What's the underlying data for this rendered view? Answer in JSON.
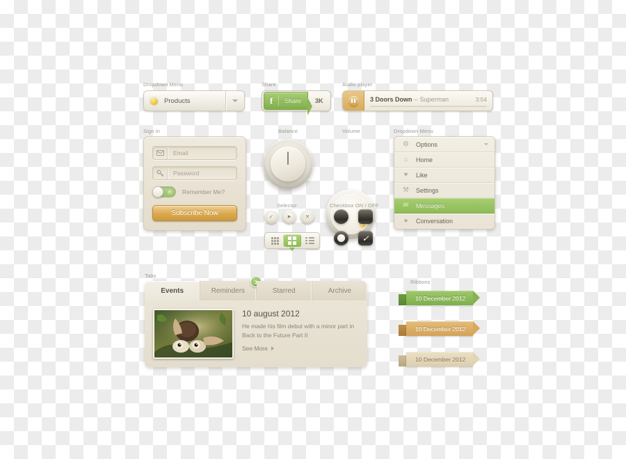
{
  "sections": {
    "dropdown_menu_btn": "Dropdown Menu",
    "share": "Share",
    "audio_player": "Audio player",
    "sign_in": "Sign in",
    "balance": "Balance",
    "volume": "Volume",
    "selector": "Selector",
    "checkbox": "Checkbox ON / OFF",
    "dropdown_menu_list": "Dropdown Menu",
    "tabs": "Tabs",
    "ribbons": "Ribbons"
  },
  "dropdown_button": {
    "label": "Products",
    "dot_color": "#f0c23c",
    "caret": "chevron-down-icon"
  },
  "share_button": {
    "icon": "f",
    "label": "Share",
    "count": "3K",
    "green": "#8cbb55"
  },
  "audio": {
    "artist": "3 Doors Down",
    "separator": "–",
    "track": "Superman",
    "time": "3:54",
    "progress_percent": 55,
    "accent": "#d2912f"
  },
  "signin": {
    "email_placeholder": "Email",
    "password_placeholder": "Password",
    "remember_label": "Remember Me?",
    "remember_on": true,
    "submit_label": "Subscribe Now",
    "submit_color": "#dba84f"
  },
  "knobs": {
    "balance_label": "Balance",
    "volume_label": "Volume",
    "volume_led_color": "#f0bc33"
  },
  "selector_buttons": [
    {
      "name": "check-button",
      "glyph": "✓"
    },
    {
      "name": "play-button",
      "glyph": "▶"
    },
    {
      "name": "close-button",
      "glyph": "✕"
    }
  ],
  "view_modes": [
    {
      "name": "small-grid-view",
      "selected": false
    },
    {
      "name": "large-grid-view",
      "selected": true
    },
    {
      "name": "list-view",
      "selected": false
    }
  ],
  "checkboxes": [
    {
      "name": "checkbox-circle-off",
      "shape": "circle",
      "checked": false
    },
    {
      "name": "checkbox-square-off",
      "shape": "square",
      "checked": false
    },
    {
      "name": "checkbox-circle-on",
      "shape": "circle",
      "checked": true
    },
    {
      "name": "checkbox-square-on",
      "shape": "square",
      "checked": true
    }
  ],
  "menu": {
    "items": [
      {
        "label": "Options",
        "icon": "gear-icon",
        "glyph": "⚙",
        "active": false,
        "caret": true
      },
      {
        "label": "Home",
        "icon": "home-icon",
        "glyph": "⌂",
        "active": false,
        "caret": false
      },
      {
        "label": "Like",
        "icon": "heart-icon",
        "glyph": "♥",
        "active": false,
        "caret": false
      },
      {
        "label": "Settings",
        "icon": "wrench-icon",
        "glyph": "⚒",
        "active": false,
        "caret": false
      },
      {
        "label": "Messages",
        "icon": "envelope-icon",
        "glyph": "✉",
        "active": true,
        "caret": false
      },
      {
        "label": "Conversation",
        "icon": "speech-bubble-icon",
        "glyph": "●",
        "active": false,
        "caret": false
      }
    ],
    "active_color": "#8ebb57"
  },
  "tabs": {
    "items": [
      {
        "label": "Events",
        "active": true,
        "badge": null
      },
      {
        "label": "Reminders",
        "active": false,
        "badge": "3"
      },
      {
        "label": "Starred",
        "active": false,
        "badge": null
      },
      {
        "label": "Archive",
        "active": false,
        "badge": null
      }
    ],
    "badge_color": "#83b34d"
  },
  "card": {
    "date": "10 august 2012",
    "description": "He made his film debut with a minor part in Back to the Future Part II",
    "more_label": "See More",
    "thumbnail": "squirrel-photo"
  },
  "ribbons": [
    {
      "label": "10 December 2012",
      "color": "#7fae4c",
      "variant": "green"
    },
    {
      "label": "10 December 2012",
      "color": "#d3a257",
      "variant": "orange"
    },
    {
      "label": "10 December 2012",
      "color": "#ddceac",
      "variant": "beige"
    }
  ]
}
